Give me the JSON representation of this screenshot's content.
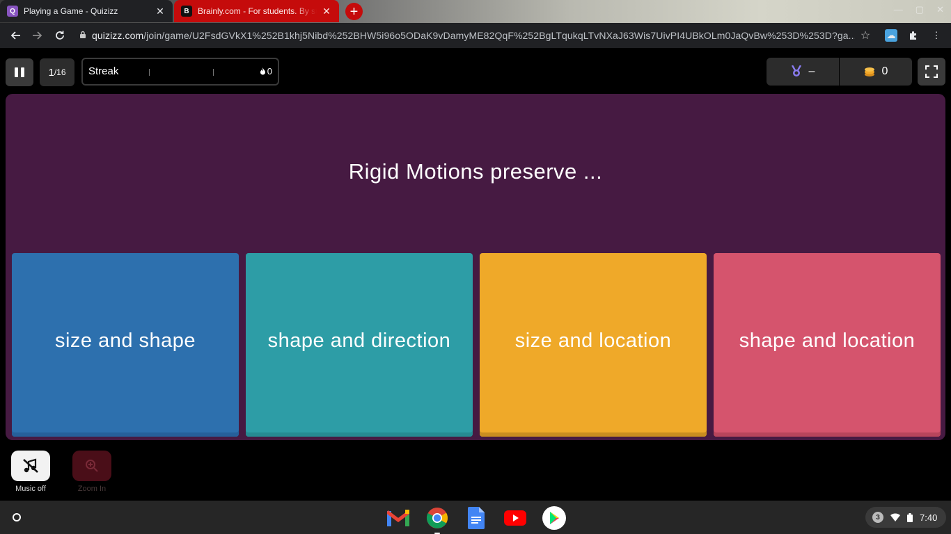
{
  "browser": {
    "tabs": [
      {
        "title": "Playing a Game - Quizizz",
        "favicon": "Q",
        "active": true
      },
      {
        "title": "Brainly.com - For students. By students.",
        "favicon": "B",
        "active": false
      }
    ],
    "url_host": "quizizz.com",
    "url_path": "/join/game/U2FsdGVkX1%252B1khj5Nibd%252BHW5i96o5ODaK9vDamyME82QqF%252BgLTqukqLTvNXaJ63Wis7UivPI4UBkOLm0JaQvBw%253D%253D?ga...",
    "tab_strip_color": "#c50b0b"
  },
  "game_header": {
    "question_current": "1",
    "question_total": "/16",
    "streak_label": "Streak",
    "streak_count": "0",
    "rank_value": "–",
    "coins_value": "0"
  },
  "question": {
    "text": "Rigid Motions preserve ...",
    "card_color": "#461a42"
  },
  "options": [
    {
      "label": "size and shape",
      "color": "#2d70ae"
    },
    {
      "label": "shape and direction",
      "color": "#2d9da6"
    },
    {
      "label": "size and location",
      "color": "#efa929"
    },
    {
      "label": "shape and location",
      "color": "#d5546d"
    }
  ],
  "controls": {
    "music_label": "Music off",
    "zoom_label": "Zoom In"
  },
  "shelf": {
    "apps": [
      "gmail-icon",
      "chrome-icon",
      "docs-icon",
      "youtube-icon",
      "play-store-icon"
    ],
    "notification_count": "3",
    "time": "7:40"
  }
}
